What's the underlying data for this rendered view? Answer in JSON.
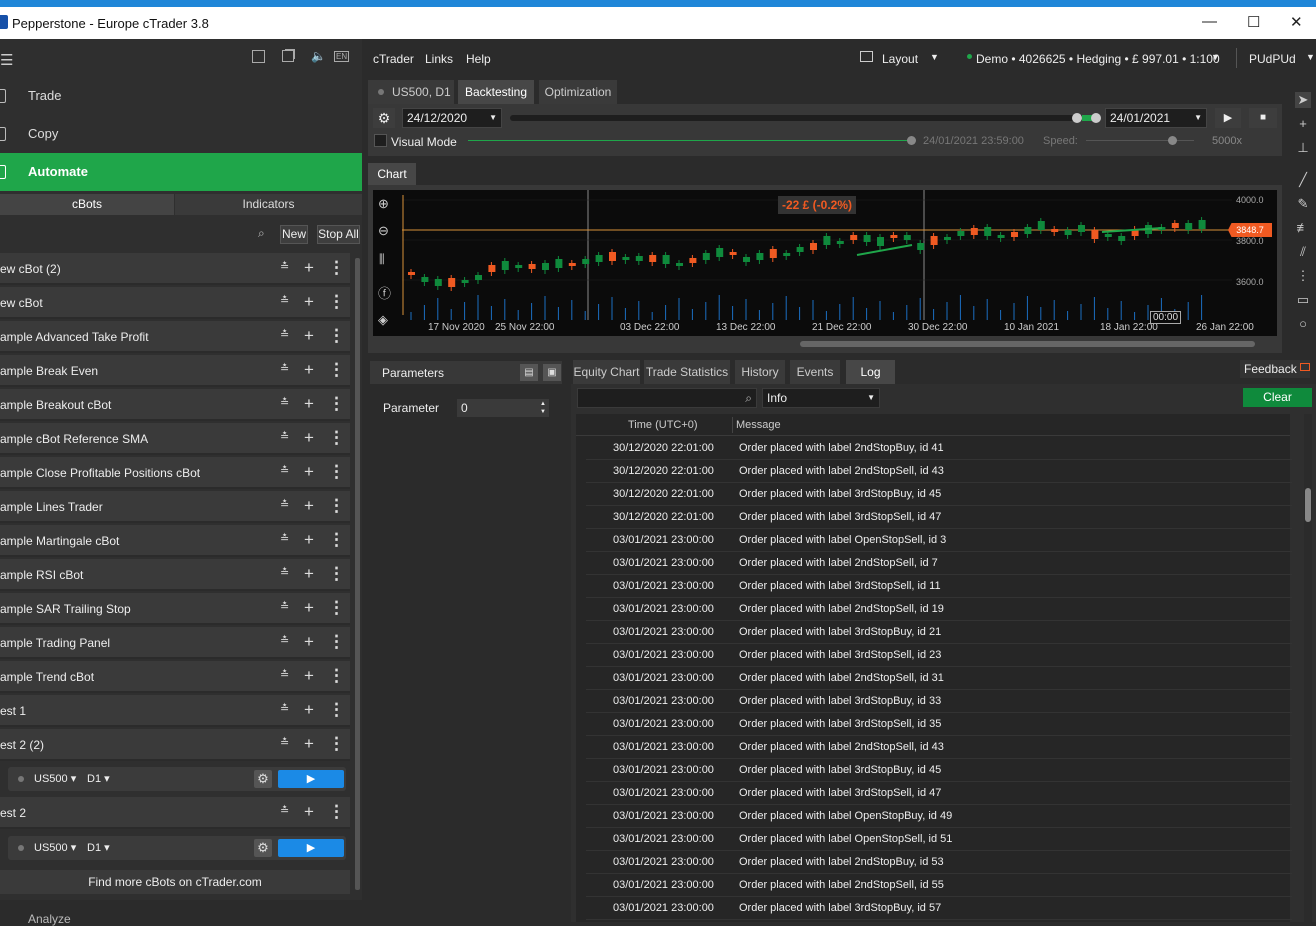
{
  "window": {
    "title": "Pepperstone - Europe cTrader 3.8",
    "minimize": "—",
    "maximize": "☐",
    "close": "✕"
  },
  "sidebar": {
    "header_icons": {
      "en": "EN"
    },
    "nav": [
      {
        "label": "Trade"
      },
      {
        "label": "Copy"
      },
      {
        "label": "Automate"
      }
    ],
    "segments": [
      "cBots",
      "Indicators"
    ],
    "search_placeholder": "",
    "new_label": "New",
    "stopall_label": "Stop All",
    "bots": [
      "ew cBot (2)",
      "ew cBot",
      "ample Advanced Take Profit",
      "ample Break Even",
      "ample Breakout cBot",
      "ample cBot Reference SMA",
      "ample Close Profitable Positions cBot",
      "ample Lines Trader",
      "ample Martingale cBot",
      "ample RSI cBot",
      "ample SAR Trailing Stop",
      "ample Trading Panel",
      "ample Trend cBot",
      "est 1",
      "est 2 (2)"
    ],
    "instance1": {
      "symbol": "US500",
      "timeframe": "D1"
    },
    "bot_last": "est 2",
    "instance2": {
      "symbol": "US500",
      "timeframe": "D1"
    },
    "find_more": "Find more cBots on cTrader.com",
    "analyze": "Analyze"
  },
  "topmenu": {
    "items": [
      "cTrader",
      "Links",
      "Help"
    ],
    "layout": "Layout",
    "account": "Demo • 4026625 • Hedging • £ 997.01 • 1:100",
    "user": "PUdPUd"
  },
  "tabs": {
    "symbol": "US500, D1",
    "backtesting": "Backtesting",
    "optimization": "Optimization"
  },
  "backtest": {
    "start_date": "24/12/2020",
    "end_date": "24/01/2021",
    "visual_mode": "Visual Mode",
    "current_time": "24/01/2021 23:59:00",
    "speed_label": "Speed:",
    "speed_value": "5000x"
  },
  "chart": {
    "tab": "Chart",
    "pnl": "-22 £ (-0.2%)",
    "price_marker": "3848.7",
    "yaxis": [
      "4000.0",
      "3800.0",
      "3600.0"
    ],
    "xaxis": [
      "17 Nov 2020",
      "25 Nov 22:00",
      "03 Dec 22:00",
      "13 Dec 22:00",
      "21 Dec 22:00",
      "30 Dec 22:00",
      "10 Jan 2021",
      "18 Jan 22:00",
      "26 Jan 22:00"
    ],
    "crosshair_time": "00:00"
  },
  "parameters": {
    "title": "Parameters",
    "param_label": "Parameter",
    "param_value": "0"
  },
  "bottom_tabs": [
    "Equity Chart",
    "Trade Statistics",
    "History",
    "Events",
    "Log"
  ],
  "feedback": "Feedback",
  "log": {
    "level": "Info",
    "clear": "Clear",
    "col_time": "Time (UTC+0)",
    "col_message": "Message",
    "rows": [
      {
        "time": "30/12/2020 22:01:00",
        "message": "Order placed with label 2ndStopBuy, id 41"
      },
      {
        "time": "30/12/2020 22:01:00",
        "message": "Order placed with label 2ndStopSell, id 43"
      },
      {
        "time": "30/12/2020 22:01:00",
        "message": "Order placed with label 3rdStopBuy, id 45"
      },
      {
        "time": "30/12/2020 22:01:00",
        "message": "Order placed with label 3rdStopSell, id 47"
      },
      {
        "time": "03/01/2021 23:00:00",
        "message": "Order placed with label OpenStopSell, id 3"
      },
      {
        "time": "03/01/2021 23:00:00",
        "message": "Order placed with label 2ndStopSell, id 7"
      },
      {
        "time": "03/01/2021 23:00:00",
        "message": "Order placed with label 3rdStopSell, id 11"
      },
      {
        "time": "03/01/2021 23:00:00",
        "message": "Order placed with label 2ndStopSell, id 19"
      },
      {
        "time": "03/01/2021 23:00:00",
        "message": "Order placed with label 3rdStopBuy, id 21"
      },
      {
        "time": "03/01/2021 23:00:00",
        "message": "Order placed with label 3rdStopSell, id 23"
      },
      {
        "time": "03/01/2021 23:00:00",
        "message": "Order placed with label 2ndStopSell, id 31"
      },
      {
        "time": "03/01/2021 23:00:00",
        "message": "Order placed with label 3rdStopBuy, id 33"
      },
      {
        "time": "03/01/2021 23:00:00",
        "message": "Order placed with label 3rdStopSell, id 35"
      },
      {
        "time": "03/01/2021 23:00:00",
        "message": "Order placed with label 2ndStopSell, id 43"
      },
      {
        "time": "03/01/2021 23:00:00",
        "message": "Order placed with label 3rdStopBuy, id 45"
      },
      {
        "time": "03/01/2021 23:00:00",
        "message": "Order placed with label 3rdStopSell, id 47"
      },
      {
        "time": "03/01/2021 23:00:00",
        "message": "Order placed with label OpenStopBuy, id 49"
      },
      {
        "time": "03/01/2021 23:00:00",
        "message": "Order placed with label OpenStopSell, id 51"
      },
      {
        "time": "03/01/2021 23:00:00",
        "message": "Order placed with label 2ndStopBuy, id 53"
      },
      {
        "time": "03/01/2021 23:00:00",
        "message": "Order placed with label 2ndStopSell, id 55"
      },
      {
        "time": "03/01/2021 23:00:00",
        "message": "Order placed with label 3rdStopBuy, id 57"
      }
    ]
  },
  "colors": {
    "accent": "#1fa64a",
    "run": "#1b8ae6",
    "bull": "#0f8a3c",
    "bear": "#f05a22",
    "price": "#f05a22"
  }
}
